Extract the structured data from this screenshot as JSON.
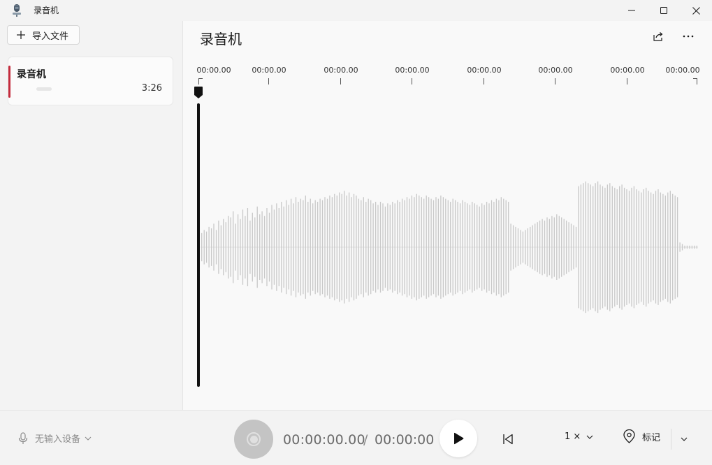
{
  "app": {
    "title": "录音机",
    "icon": "microphone-app-icon"
  },
  "window_controls": {
    "minimize": "minimize-icon",
    "maximize": "maximize-icon",
    "close": "close-icon"
  },
  "sidebar": {
    "import_label": "导入文件",
    "recordings": [
      {
        "name": "录音机",
        "duration": "3:26",
        "accent_color": "#c42b3c"
      }
    ]
  },
  "main": {
    "title": "录音机",
    "share_icon": "share-icon",
    "more_icon": "more-icon",
    "timeline_labels": [
      "00:00.00",
      "00:00.00",
      "00:00.00",
      "00:00.00",
      "00:00.00",
      "00:00.00",
      "00:00.00",
      "00:00.00"
    ]
  },
  "waveform": {
    "amplitudes": [
      0.18,
      0.22,
      0.2,
      0.26,
      0.24,
      0.3,
      0.22,
      0.34,
      0.28,
      0.36,
      0.32,
      0.4,
      0.38,
      0.46,
      0.3,
      0.42,
      0.36,
      0.48,
      0.4,
      0.5,
      0.34,
      0.44,
      0.38,
      0.52,
      0.42,
      0.46,
      0.4,
      0.5,
      0.44,
      0.54,
      0.48,
      0.56,
      0.5,
      0.58,
      0.52,
      0.6,
      0.54,
      0.62,
      0.56,
      0.64,
      0.58,
      0.62,
      0.6,
      0.66,
      0.58,
      0.62,
      0.56,
      0.6,
      0.58,
      0.62,
      0.6,
      0.64,
      0.62,
      0.66,
      0.64,
      0.68,
      0.66,
      0.7,
      0.68,
      0.72,
      0.66,
      0.7,
      0.64,
      0.68,
      0.66,
      0.62,
      0.6,
      0.64,
      0.58,
      0.62,
      0.6,
      0.56,
      0.58,
      0.54,
      0.58,
      0.56,
      0.52,
      0.56,
      0.54,
      0.58,
      0.56,
      0.6,
      0.58,
      0.62,
      0.6,
      0.64,
      0.62,
      0.66,
      0.64,
      0.68,
      0.66,
      0.64,
      0.62,
      0.66,
      0.64,
      0.62,
      0.6,
      0.64,
      0.62,
      0.66,
      0.64,
      0.62,
      0.6,
      0.58,
      0.62,
      0.6,
      0.58,
      0.56,
      0.6,
      0.58,
      0.56,
      0.54,
      0.58,
      0.56,
      0.54,
      0.52,
      0.56,
      0.54,
      0.58,
      0.56,
      0.6,
      0.58,
      0.62,
      0.6,
      0.64,
      0.62,
      0.6,
      0.58,
      0.3,
      0.28,
      0.26,
      0.24,
      0.22,
      0.2,
      0.22,
      0.24,
      0.26,
      0.28,
      0.3,
      0.32,
      0.34,
      0.36,
      0.34,
      0.38,
      0.36,
      0.4,
      0.38,
      0.42,
      0.4,
      0.38,
      0.36,
      0.34,
      0.32,
      0.3,
      0.28,
      0.26,
      0.78,
      0.8,
      0.82,
      0.84,
      0.82,
      0.8,
      0.78,
      0.82,
      0.84,
      0.8,
      0.78,
      0.76,
      0.8,
      0.82,
      0.78,
      0.76,
      0.74,
      0.78,
      0.8,
      0.76,
      0.74,
      0.72,
      0.76,
      0.78,
      0.74,
      0.72,
      0.7,
      0.74,
      0.76,
      0.72,
      0.7,
      0.68,
      0.72,
      0.74,
      0.7,
      0.68,
      0.66,
      0.7,
      0.72,
      0.68,
      0.66,
      0.64,
      0.06,
      0.04,
      0.02,
      0.02,
      0.02,
      0.02,
      0.02,
      0.02
    ],
    "color": "#c8c8c8"
  },
  "playback": {
    "current_time": "00:00:00.00",
    "separator": "/",
    "total_time": "00:00:00",
    "position_fraction": 0
  },
  "bottom": {
    "mic_label": "无输入设备",
    "speed_label": "1 ×",
    "mark_label": "标记"
  }
}
